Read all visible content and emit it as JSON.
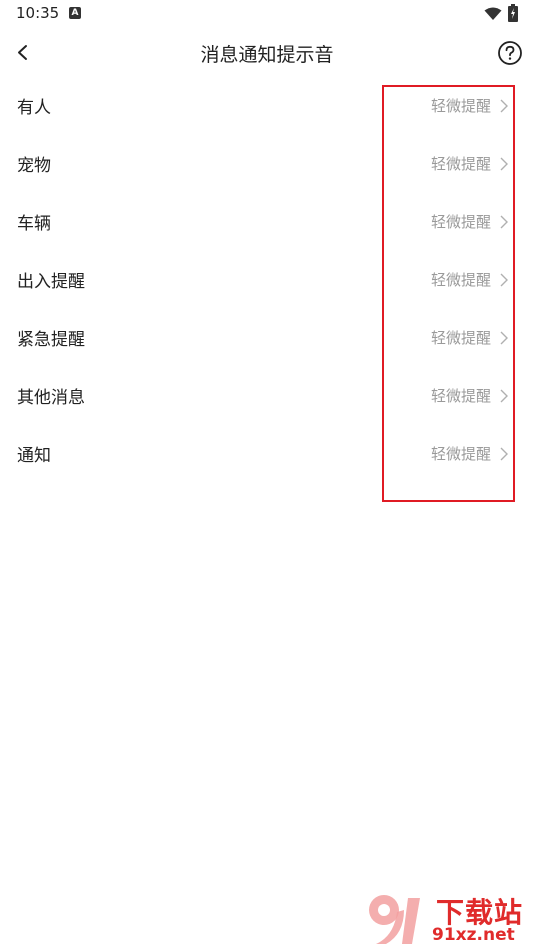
{
  "status_bar": {
    "time": "10:35"
  },
  "header": {
    "title": "消息通知提示音"
  },
  "rows": [
    {
      "label": "有人",
      "value": "轻微提醒"
    },
    {
      "label": "宠物",
      "value": "轻微提醒"
    },
    {
      "label": "车辆",
      "value": "轻微提醒"
    },
    {
      "label": "出入提醒",
      "value": "轻微提醒"
    },
    {
      "label": "紧急提醒",
      "value": "轻微提醒"
    },
    {
      "label": "其他消息",
      "value": "轻微提醒"
    },
    {
      "label": "通知",
      "value": "轻微提醒"
    }
  ],
  "watermark": {
    "name": "下载站",
    "url": "91xz.net",
    "logo_text": "91"
  },
  "colors": {
    "highlight": "#e01b24",
    "value_text": "#9a9a9a",
    "watermark": "#e02b2b"
  }
}
